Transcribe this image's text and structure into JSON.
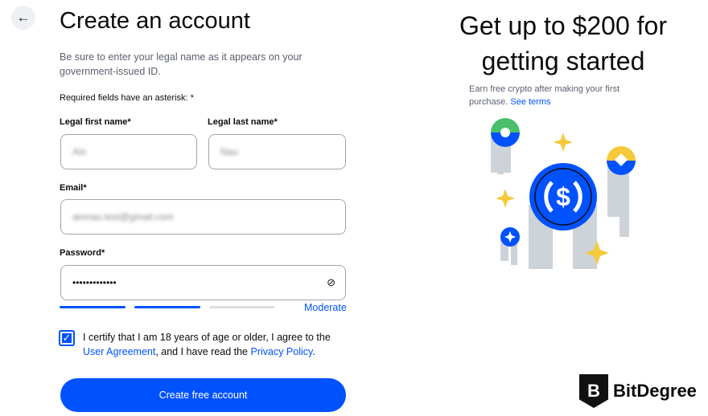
{
  "form": {
    "back_icon": "arrow-left-icon",
    "title": "Create an account",
    "subtitle": "Be sure to enter your legal name as it appears on your government-issued ID.",
    "required_note": "Required fields have an asterisk: *",
    "first_name_label": "Legal first name*",
    "first_name_value": "Ain",
    "last_name_label": "Legal last name*",
    "last_name_value": "Nau",
    "email_label": "Email*",
    "email_value": "ainnau.test@gmail.com",
    "password_label": "Password*",
    "password_value": "•••••••••••••",
    "password_strength": "Moderate",
    "strength_level": "2/3",
    "certify_checked": true,
    "certify_text": "I certify that I am 18 years of age or older, I agree to the",
    "user_agreement": "User Agreement",
    "certify_mid": ", and I have read the",
    "privacy_policy": "Privacy Policy",
    "certify_end": ".",
    "submit_label": "Create free account"
  },
  "promo": {
    "title": "Get up to $200 for getting started",
    "text": "Earn free crypto after making your first purchase.",
    "see_terms": "See terms"
  },
  "colors": {
    "accent": "#0052ff",
    "star": "#f5c93a",
    "green": "#4bbf6b",
    "gray": "#ced2d9"
  },
  "watermark": {
    "text": "BitDegree"
  }
}
